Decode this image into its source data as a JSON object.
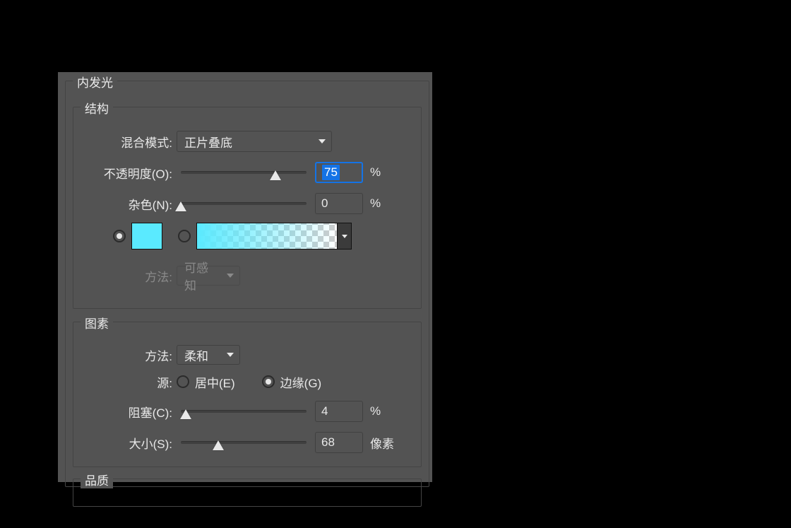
{
  "panel": {
    "title": "内发光",
    "sections": {
      "structure": {
        "title": "结构",
        "blend_mode": {
          "label": "混合模式:",
          "value": "正片叠底"
        },
        "opacity": {
          "label": "不透明度(O):",
          "value": "75",
          "unit": "%"
        },
        "noise": {
          "label": "杂色(N):",
          "value": "0",
          "unit": "%"
        },
        "color_swatch": "#5AEAFF",
        "method": {
          "label": "方法:",
          "value": "可感知"
        }
      },
      "elements": {
        "title": "图素",
        "technique": {
          "label": "方法:",
          "value": "柔和"
        },
        "source": {
          "label": "源:",
          "options": {
            "center": "居中(E)",
            "edge": "边缘(G)"
          },
          "selected": "edge"
        },
        "choke": {
          "label": "阻塞(C):",
          "value": "4",
          "unit": "%"
        },
        "size": {
          "label": "大小(S):",
          "value": "68",
          "unit": "像素"
        }
      },
      "quality": {
        "title": "品质"
      }
    }
  }
}
